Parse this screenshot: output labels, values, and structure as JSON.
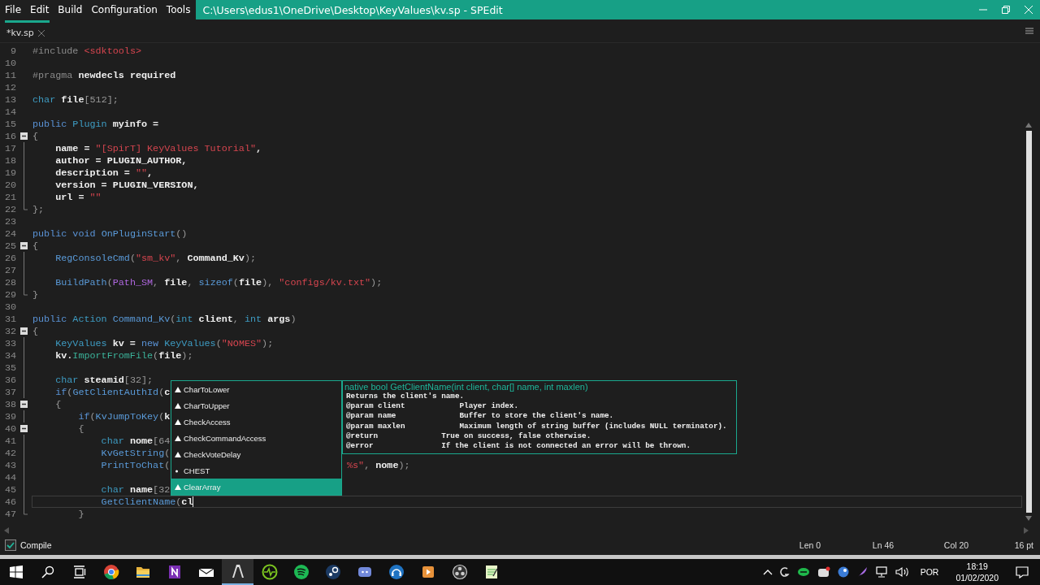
{
  "menu": [
    "File",
    "Edit",
    "Build",
    "Configuration",
    "Tools"
  ],
  "window": {
    "title": "C:\\Users\\edus1\\OneDrive\\Desktop\\KeyValues\\kv.sp - SPEdit"
  },
  "tabs": [
    {
      "label": "*kv.sp",
      "selected": true
    }
  ],
  "editor": {
    "lines": [
      {
        "number": "9",
        "current": false,
        "kind": "plain",
        "tokens": [
          {
            "kind": "pre",
            "text": "#include "
          },
          {
            "kind": "str",
            "text": "<sdktools>"
          }
        ]
      },
      {
        "number": "10",
        "current": false,
        "kind": "plain"
      },
      {
        "number": "11",
        "current": false,
        "kind": "plain",
        "tokens": [
          {
            "kind": "pre",
            "text": "#pragma "
          },
          {
            "kind": "id",
            "text": "newdecls required"
          }
        ]
      },
      {
        "number": "12",
        "current": false,
        "kind": "plain"
      },
      {
        "number": "13",
        "current": false,
        "kind": "plain",
        "tokens": [
          {
            "kind": "type",
            "text": "char "
          },
          {
            "kind": "id",
            "text": "file"
          },
          {
            "kind": "punct",
            "text": "[512];"
          }
        ]
      },
      {
        "number": "14",
        "current": false,
        "kind": "plain"
      },
      {
        "number": "15",
        "current": false,
        "kind": "plain",
        "tokens": [
          {
            "kind": "kw",
            "text": "public "
          },
          {
            "kind": "type",
            "text": "Plugin "
          },
          {
            "kind": "id",
            "text": "myinfo ="
          }
        ]
      },
      {
        "number": "16",
        "current": false,
        "kind": "block-start",
        "folded": false,
        "tokens": [
          {
            "kind": "punct",
            "text": "{"
          }
        ]
      },
      {
        "number": "17",
        "current": false,
        "kind": "block-line",
        "tokens": [
          {
            "kind": "id",
            "text": "    name = "
          },
          {
            "kind": "str",
            "text": "\"[SpirT] KeyValues Tutorial\""
          },
          {
            "kind": "id",
            "text": ","
          }
        ]
      },
      {
        "number": "18",
        "current": false,
        "kind": "block-line",
        "tokens": [
          {
            "kind": "id",
            "text": "    author = PLUGIN_AUTHOR,"
          }
        ]
      },
      {
        "number": "19",
        "current": false,
        "kind": "block-line",
        "tokens": [
          {
            "kind": "id",
            "text": "    description = "
          },
          {
            "kind": "str",
            "text": "\"\""
          },
          {
            "kind": "id",
            "text": ","
          }
        ]
      },
      {
        "number": "20",
        "current": false,
        "kind": "block-line",
        "tokens": [
          {
            "kind": "id",
            "text": "    version = PLUGIN_VERSION,"
          }
        ]
      },
      {
        "number": "21",
        "current": false,
        "kind": "block-line",
        "tokens": [
          {
            "kind": "id",
            "text": "    url = "
          },
          {
            "kind": "str",
            "text": "\"\""
          }
        ]
      },
      {
        "number": "22",
        "current": false,
        "kind": "block-end",
        "tokens": [
          {
            "kind": "punct",
            "text": "};"
          }
        ]
      },
      {
        "number": "23",
        "current": false,
        "kind": "plain"
      },
      {
        "number": "24",
        "current": false,
        "kind": "plain",
        "tokens": [
          {
            "kind": "kw",
            "text": "public void "
          },
          {
            "kind": "func",
            "text": "OnPluginStart"
          },
          {
            "kind": "punct",
            "text": "()"
          }
        ]
      },
      {
        "number": "25",
        "current": false,
        "kind": "block-start",
        "folded": false,
        "tokens": [
          {
            "kind": "punct",
            "text": "{"
          }
        ]
      },
      {
        "number": "26",
        "current": false,
        "kind": "block-line",
        "tokens": [
          {
            "kind": "func",
            "text": "    RegConsoleCmd"
          },
          {
            "kind": "punct",
            "text": "("
          },
          {
            "kind": "str",
            "text": "\"sm_kv\""
          },
          {
            "kind": "punct",
            "text": ", "
          },
          {
            "kind": "id",
            "text": "Command_Kv"
          },
          {
            "kind": "punct",
            "text": ");"
          }
        ]
      },
      {
        "number": "27",
        "current": false,
        "kind": "block-line"
      },
      {
        "number": "28",
        "current": false,
        "kind": "block-line",
        "tokens": [
          {
            "kind": "func",
            "text": "    BuildPath"
          },
          {
            "kind": "punct",
            "text": "("
          },
          {
            "kind": "const",
            "text": "Path_SM"
          },
          {
            "kind": "punct",
            "text": ", "
          },
          {
            "kind": "id",
            "text": "file"
          },
          {
            "kind": "punct",
            "text": ", "
          },
          {
            "kind": "func",
            "text": "sizeof"
          },
          {
            "kind": "punct",
            "text": "("
          },
          {
            "kind": "id",
            "text": "file"
          },
          {
            "kind": "punct",
            "text": "), "
          },
          {
            "kind": "str",
            "text": "\"configs/kv.txt\""
          },
          {
            "kind": "punct",
            "text": ");"
          }
        ]
      },
      {
        "number": "29",
        "current": false,
        "kind": "block-end",
        "tokens": [
          {
            "kind": "punct",
            "text": "}"
          }
        ]
      },
      {
        "number": "30",
        "current": false,
        "kind": "plain"
      },
      {
        "number": "31",
        "current": false,
        "kind": "plain",
        "tokens": [
          {
            "kind": "kw",
            "text": "public "
          },
          {
            "kind": "type",
            "text": "Action "
          },
          {
            "kind": "func",
            "text": "Command_Kv"
          },
          {
            "kind": "punct",
            "text": "("
          },
          {
            "kind": "type",
            "text": "int "
          },
          {
            "kind": "id",
            "text": "client"
          },
          {
            "kind": "punct",
            "text": ", "
          },
          {
            "kind": "type",
            "text": "int "
          },
          {
            "kind": "id",
            "text": "args"
          },
          {
            "kind": "punct",
            "text": ")"
          }
        ]
      },
      {
        "number": "32",
        "current": false,
        "kind": "block-start",
        "folded": false,
        "tokens": [
          {
            "kind": "punct",
            "text": "{"
          }
        ]
      },
      {
        "number": "33",
        "current": false,
        "kind": "block-line",
        "tokens": [
          {
            "kind": "type",
            "text": "    KeyValues "
          },
          {
            "kind": "id",
            "text": "kv = "
          },
          {
            "kind": "kw",
            "text": "new "
          },
          {
            "kind": "type",
            "text": "KeyValues"
          },
          {
            "kind": "punct",
            "text": "("
          },
          {
            "kind": "str",
            "text": "\"NOMES\""
          },
          {
            "kind": "punct",
            "text": ");"
          }
        ]
      },
      {
        "number": "34",
        "current": false,
        "kind": "block-line",
        "tokens": [
          {
            "kind": "id",
            "text": "    kv."
          },
          {
            "kind": "method",
            "text": "ImportFromFile"
          },
          {
            "kind": "punct",
            "text": "("
          },
          {
            "kind": "id",
            "text": "file"
          },
          {
            "kind": "punct",
            "text": ");"
          }
        ]
      },
      {
        "number": "35",
        "current": false,
        "kind": "block-line"
      },
      {
        "number": "36",
        "current": false,
        "kind": "block-line",
        "tokens": [
          {
            "kind": "type",
            "text": "    char "
          },
          {
            "kind": "id",
            "text": "steamid"
          },
          {
            "kind": "punct",
            "text": "[32];"
          }
        ]
      },
      {
        "number": "37",
        "current": false,
        "kind": "block-line",
        "tokens": [
          {
            "kind": "kw",
            "text": "    if"
          },
          {
            "kind": "punct",
            "text": "("
          },
          {
            "kind": "func",
            "text": "GetClientAuthId"
          },
          {
            "kind": "punct",
            "text": "("
          },
          {
            "kind": "id",
            "text": "c"
          }
        ]
      },
      {
        "number": "38",
        "current": false,
        "kind": "block-start",
        "folded": false,
        "tokens": [
          {
            "kind": "punct",
            "text": "    {"
          }
        ]
      },
      {
        "number": "39",
        "current": false,
        "kind": "block-line",
        "tokens": [
          {
            "kind": "kw",
            "text": "        if"
          },
          {
            "kind": "punct",
            "text": "("
          },
          {
            "kind": "func",
            "text": "KvJumpToKey"
          },
          {
            "kind": "punct",
            "text": "("
          },
          {
            "kind": "id",
            "text": "k"
          }
        ]
      },
      {
        "number": "40",
        "current": false,
        "kind": "block-start",
        "folded": false,
        "tokens": [
          {
            "kind": "punct",
            "text": "        {"
          }
        ]
      },
      {
        "number": "41",
        "current": false,
        "kind": "block-line",
        "tokens": [
          {
            "kind": "type",
            "text": "            char "
          },
          {
            "kind": "id",
            "text": "nome"
          },
          {
            "kind": "punct",
            "text": "[64"
          }
        ]
      },
      {
        "number": "42",
        "current": false,
        "kind": "block-line",
        "tokens": [
          {
            "kind": "func",
            "text": "            KvGetString"
          },
          {
            "kind": "punct",
            "text": "("
          }
        ]
      },
      {
        "number": "43",
        "current": false,
        "kind": "block-line",
        "tokens": [
          {
            "kind": "func",
            "text": "            PrintToChat"
          },
          {
            "kind": "punct",
            "text": "("
          }
        ],
        "tail": [
          {
            "kind": "str",
            "text": "%s\""
          },
          {
            "kind": "punct",
            "text": ", "
          },
          {
            "kind": "id",
            "text": "nome"
          },
          {
            "kind": "punct",
            "text": ");"
          }
        ]
      },
      {
        "number": "44",
        "current": false,
        "kind": "block-line"
      },
      {
        "number": "45",
        "current": false,
        "kind": "block-line",
        "tokens": [
          {
            "kind": "type",
            "text": "            char "
          },
          {
            "kind": "id",
            "text": "name"
          },
          {
            "kind": "punct",
            "text": "[32"
          }
        ]
      },
      {
        "number": "46",
        "current": true,
        "kind": "block-line",
        "tokens": [
          {
            "kind": "func",
            "text": "            GetClientName"
          },
          {
            "kind": "punct",
            "text": "("
          },
          {
            "kind": "id",
            "text": "cl"
          }
        ]
      },
      {
        "number": "47",
        "current": false,
        "kind": "block-end",
        "tokens": [
          {
            "kind": "punct",
            "text": "        }"
          }
        ]
      }
    ]
  },
  "autocomplete": {
    "items": [
      {
        "label": "CharToLower",
        "kind": "method",
        "selected": false
      },
      {
        "label": "CharToUpper",
        "kind": "method",
        "selected": false
      },
      {
        "label": "CheckAccess",
        "kind": "method",
        "selected": false
      },
      {
        "label": "CheckCommandAccess",
        "kind": "method",
        "selected": false
      },
      {
        "label": "CheckVoteDelay",
        "kind": "method",
        "selected": false
      },
      {
        "label": "CHEST",
        "kind": "constant",
        "selected": false
      },
      {
        "label": "ClearArray",
        "kind": "method",
        "selected": true
      }
    ]
  },
  "tooltip": {
    "signature": "native bool GetClientName(int client, char[] name, int maxlen)",
    "lines": [
      "Returns the client's name.",
      "@param client            Player index.",
      "@param name              Buffer to store the client's name.",
      "@param maxlen            Maximum length of string buffer (includes NULL terminator).",
      "@return              True on success, false otherwise.",
      "@error               If the client is not connected an error will be thrown."
    ]
  },
  "status_bar": {
    "compile": {
      "label": "Compile",
      "checked": true
    },
    "len": "Len 0",
    "ln": "Ln 46",
    "col": "Col 20",
    "zoom": "16 pt"
  },
  "taskbar": {
    "language": "POR",
    "time": "18:19",
    "date": "01/02/2020"
  }
}
